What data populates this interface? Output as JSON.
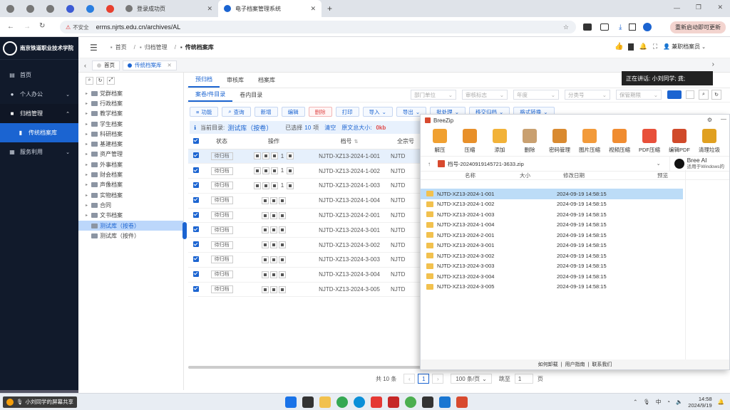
{
  "browser": {
    "tabs": [
      {
        "label": "登录成功页"
      },
      {
        "label": "电子档案管理系统"
      }
    ],
    "security": "不安全",
    "url": "erms.njrts.edu.cn/archives/AL",
    "restart_label": "重新启动即可更新"
  },
  "app": {
    "school_name": "南京铁道职业技术学院",
    "breadcrumb": [
      "首页",
      "归档管理",
      "传统档案库"
    ],
    "user": "兼职档案员",
    "sidebar": [
      {
        "label": "首页"
      },
      {
        "label": "个人办公"
      },
      {
        "label": "归档管理"
      },
      {
        "label": "传统档案库"
      },
      {
        "label": "服务利用"
      }
    ],
    "page_tabs": [
      "首页",
      "传统档案库"
    ],
    "tree": [
      "党群档案",
      "行政档案",
      "教学档案",
      "学生档案",
      "科研档案",
      "基建档案",
      "资产管理",
      "外事档案",
      "财会档案",
      "声像档案",
      "实物档案",
      "合同",
      "文书档案"
    ],
    "tree_leaves": [
      "测试库（按卷）",
      "测试库（按件）"
    ],
    "main_tabs": [
      "预归档",
      "审核库",
      "档案库"
    ],
    "sub_tabs": [
      "案卷/件目录",
      "卷内目录"
    ],
    "filters": [
      "部门单位",
      "审核标志",
      "年度",
      "分类号",
      "保管期限"
    ],
    "toolbar": [
      "功能",
      "查询",
      "新增",
      "编辑",
      "删除",
      "打印",
      "导入",
      "导出",
      "批处理",
      "移交归档",
      "格式转换"
    ],
    "info": {
      "prefix": "当前目录:",
      "catalog": "测试库（按卷）",
      "selected_prefix": "已选择",
      "selected_count": "10",
      "selected_unit": "项",
      "clear": "清空",
      "size_label": "原文总大小:",
      "size": "0kb"
    },
    "columns": [
      "状态",
      "操作",
      "档号",
      "全宗号"
    ],
    "rows": [
      {
        "status": "待归档",
        "num": "1",
        "code": "NJTD-XZ13-2024-1-001",
        "fonds": "NJTD"
      },
      {
        "status": "待归档",
        "num": "1",
        "code": "NJTD-XZ13-2024-1-002",
        "fonds": "NJTD"
      },
      {
        "status": "待归档",
        "num": "1",
        "code": "NJTD-XZ13-2024-1-003",
        "fonds": "NJTD"
      },
      {
        "status": "待归档",
        "num": "",
        "code": "NJTD-XZ13-2024-1-004",
        "fonds": "NJTD"
      },
      {
        "status": "待归档",
        "num": "",
        "code": "NJTD-XZ13-2024-2-001",
        "fonds": "NJTD"
      },
      {
        "status": "待归档",
        "num": "",
        "code": "NJTD-XZ13-2024-3-001",
        "fonds": "NJTD"
      },
      {
        "status": "待归档",
        "num": "",
        "code": "NJTD-XZ13-2024-3-002",
        "fonds": "NJTD"
      },
      {
        "status": "待归档",
        "num": "",
        "code": "NJTD-XZ13-2024-3-003",
        "fonds": "NJTD"
      },
      {
        "status": "待归档",
        "num": "",
        "code": "NJTD-XZ13-2024-3-004",
        "fonds": "NJTD"
      },
      {
        "status": "待归档",
        "num": "",
        "code": "NJTD-XZ13-2024-3-005",
        "fonds": "NJTD"
      }
    ],
    "pager": {
      "total": "共 10 条",
      "page": "1",
      "per_page": "100 条/页",
      "goto": "跳至",
      "goto_value": "1",
      "page_unit": "页"
    }
  },
  "speaking": "正在讲话: 小刘同学; 龚;",
  "breezip": {
    "title": "BreeZip",
    "tools": [
      "解压",
      "压缩",
      "添加",
      "删除",
      "密码管理",
      "图片压缩",
      "视频压缩",
      "PDF压缩",
      "编辑PDF",
      "清理垃圾"
    ],
    "path": "档号-20240919145721-3633.zip",
    "ai_title": "Bree AI",
    "ai_sub": "适用于Windows的",
    "columns": [
      "名称",
      "大小",
      "修改日期"
    ],
    "preview": "预览",
    "files": [
      {
        "name": "NJTD-XZ13-2024-1-001",
        "date": "2024-09-19 14:58:15"
      },
      {
        "name": "NJTD-XZ13-2024-1-002",
        "date": "2024-09-19 14:58:15"
      },
      {
        "name": "NJTD-XZ13-2024-1-003",
        "date": "2024-09-19 14:58:15"
      },
      {
        "name": "NJTD-XZ13-2024-1-004",
        "date": "2024-09-19 14:58:15"
      },
      {
        "name": "NJTD-XZ13-2024-2-001",
        "date": "2024-09-19 14:58:15"
      },
      {
        "name": "NJTD-XZ13-2024-3-001",
        "date": "2024-09-19 14:58:15"
      },
      {
        "name": "NJTD-XZ13-2024-3-002",
        "date": "2024-09-19 14:58:15"
      },
      {
        "name": "NJTD-XZ13-2024-3-003",
        "date": "2024-09-19 14:58:15"
      },
      {
        "name": "NJTD-XZ13-2024-3-004",
        "date": "2024-09-19 14:58:15"
      },
      {
        "name": "NJTD-XZ13-2024-3-005",
        "date": "2024-09-19 14:58:15"
      }
    ],
    "footer": [
      "如何卸载",
      "用户指南",
      "联系我们"
    ]
  },
  "taskbar": {
    "share": "小刘同学的屏幕共享",
    "time": "14:58",
    "date": "2024/9/19",
    "ime": "中"
  },
  "colors": {
    "accent": "#1b64d1",
    "sidebar": "#111a2b",
    "delete": "#e04a4a"
  }
}
